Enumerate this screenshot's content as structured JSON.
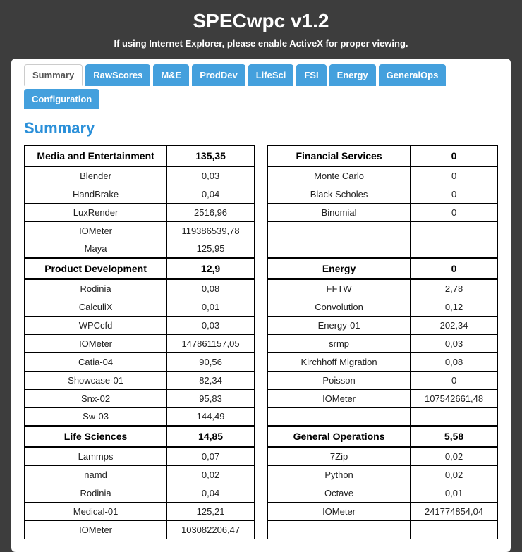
{
  "title": "SPECwpc v1.2",
  "notice": "If using Internet Explorer, please enable ActiveX for proper viewing.",
  "tabs": [
    "Summary",
    "RawScores",
    "M&E",
    "ProdDev",
    "LifeSci",
    "FSI",
    "Energy",
    "GeneralOps",
    "Configuration"
  ],
  "active_tab": 0,
  "section_title": "Summary",
  "left": [
    {
      "header": true,
      "label": "Media and Entertainment",
      "value": "135,35"
    },
    {
      "label": "Blender",
      "value": "0,03"
    },
    {
      "label": "HandBrake",
      "value": "0,04"
    },
    {
      "label": "LuxRender",
      "value": "2516,96"
    },
    {
      "label": "IOMeter",
      "value": "119386539,78"
    },
    {
      "label": "Maya",
      "value": "125,95"
    },
    {
      "header": true,
      "label": "Product Development",
      "value": "12,9"
    },
    {
      "label": "Rodinia",
      "value": "0,08"
    },
    {
      "label": "CalculiX",
      "value": "0,01"
    },
    {
      "label": "WPCcfd",
      "value": "0,03"
    },
    {
      "label": "IOMeter",
      "value": "147861157,05"
    },
    {
      "label": "Catia-04",
      "value": "90,56"
    },
    {
      "label": "Showcase-01",
      "value": "82,34"
    },
    {
      "label": "Snx-02",
      "value": "95,83"
    },
    {
      "label": "Sw-03",
      "value": "144,49"
    },
    {
      "header": true,
      "label": "Life Sciences",
      "value": "14,85"
    },
    {
      "label": "Lammps",
      "value": "0,07"
    },
    {
      "label": "namd",
      "value": "0,02"
    },
    {
      "label": "Rodinia",
      "value": "0,04"
    },
    {
      "label": "Medical-01",
      "value": "125,21"
    },
    {
      "label": "IOMeter",
      "value": "103082206,47"
    }
  ],
  "right": [
    {
      "header": true,
      "label": "Financial Services",
      "value": "0"
    },
    {
      "label": "Monte Carlo",
      "value": "0"
    },
    {
      "label": "Black Scholes",
      "value": "0"
    },
    {
      "label": "Binomial",
      "value": "0"
    },
    {
      "empty": true
    },
    {
      "empty": true
    },
    {
      "header": true,
      "label": "Energy",
      "value": "0"
    },
    {
      "label": "FFTW",
      "value": "2,78"
    },
    {
      "label": "Convolution",
      "value": "0,12"
    },
    {
      "label": "Energy-01",
      "value": "202,34"
    },
    {
      "label": "srmp",
      "value": "0,03"
    },
    {
      "label": "Kirchhoff Migration",
      "value": "0,08"
    },
    {
      "label": "Poisson",
      "value": "0"
    },
    {
      "label": "IOMeter",
      "value": "107542661,48"
    },
    {
      "empty": true
    },
    {
      "header": true,
      "label": "General Operations",
      "value": "5,58"
    },
    {
      "label": "7Zip",
      "value": "0,02"
    },
    {
      "label": "Python",
      "value": "0,02"
    },
    {
      "label": "Octave",
      "value": "0,01"
    },
    {
      "label": "IOMeter",
      "value": "241774854,04"
    },
    {
      "empty": true
    }
  ]
}
